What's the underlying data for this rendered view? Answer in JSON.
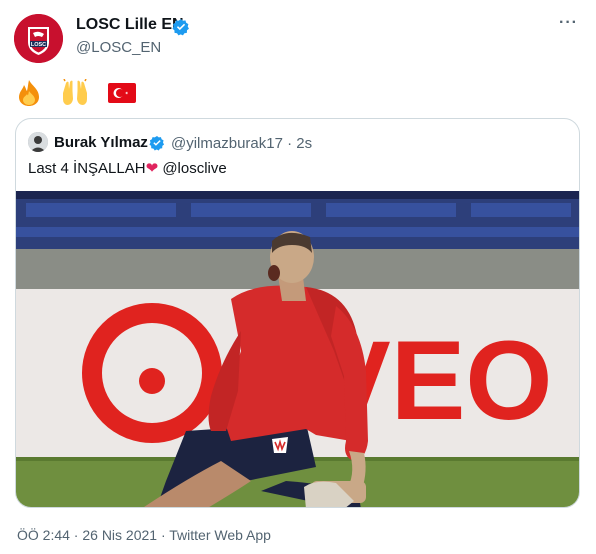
{
  "tweet": {
    "display_name": "LOSC Lille EN",
    "handle": "@LOSC_EN",
    "avatar_text": "LOSC",
    "more_icon": "ellipsis-icon",
    "emojis": [
      "fire-emoji",
      "raised-hands-emoji",
      "turkey-flag-emoji"
    ],
    "timestamp": "ÖÖ 2:44 · 26 Nis 2021 · Twitter Web App"
  },
  "quoted_tweet": {
    "display_name": "Burak Yılmaz",
    "handle_time": "@yilmazburak17 · 2s",
    "text": "Last 4 İNŞALLAH",
    "heart": "❤",
    "mention": "@losclive",
    "photo_banner_text": "VEO"
  },
  "colors": {
    "verified": "#1d9bf0",
    "losc_red": "#c8102e",
    "jersey_red": "#d52b2b",
    "pitch_green": "#6f8f3f",
    "handle_grey": "#536471"
  }
}
